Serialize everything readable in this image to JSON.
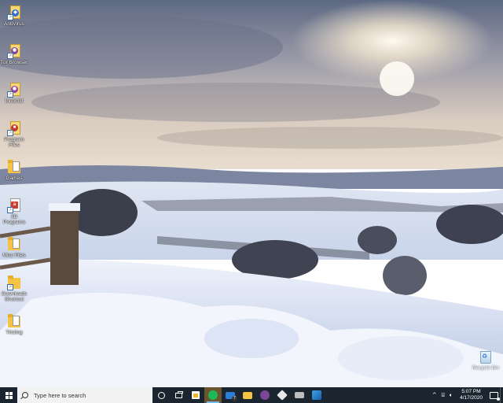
{
  "desktop": {
    "icons": [
      {
        "label": "AntiVirus",
        "icon": "antivirus-shortcut-icon"
      },
      {
        "label": "Tor Browser",
        "icon": "tor-browser-icon"
      },
      {
        "label": "Incomid",
        "icon": "incomid-icon"
      },
      {
        "label": "Program Files",
        "icon": "folder-icon"
      },
      {
        "label": "Games",
        "icon": "folder-icon"
      },
      {
        "label": "3D Programs",
        "icon": "document-shortcut-icon"
      },
      {
        "label": "Misc Files",
        "icon": "folder-icon"
      },
      {
        "label": "Downloads Shortcut",
        "icon": "folder-shortcut-icon"
      },
      {
        "label": "Tristing",
        "icon": "folder-icon"
      }
    ],
    "recycle_bin": {
      "label": "Recycle Bin",
      "icon": "recycle-bin-icon"
    }
  },
  "taskbar": {
    "search": {
      "placeholder": "Type here to search"
    },
    "apps": [
      {
        "name": "spotify",
        "icon": "spotify-icon"
      },
      {
        "name": "mail",
        "icon": "mail-icon",
        "badge": "7"
      },
      {
        "name": "file-explorer",
        "icon": "folder-icon"
      },
      {
        "name": "tor-browser",
        "icon": "tor-browser-icon"
      },
      {
        "name": "app-cube",
        "icon": "cube-icon"
      },
      {
        "name": "app-misc",
        "icon": "app-icon"
      },
      {
        "name": "photos",
        "icon": "photos-icon"
      }
    ],
    "tray": {
      "chevron": "^",
      "clock_time": "5:07 PM",
      "clock_date": "4/17/2020"
    }
  },
  "colors": {
    "taskbar_bg": "#1b2530",
    "active_app_bg": "#6b5430",
    "folder": "#f4c244"
  }
}
